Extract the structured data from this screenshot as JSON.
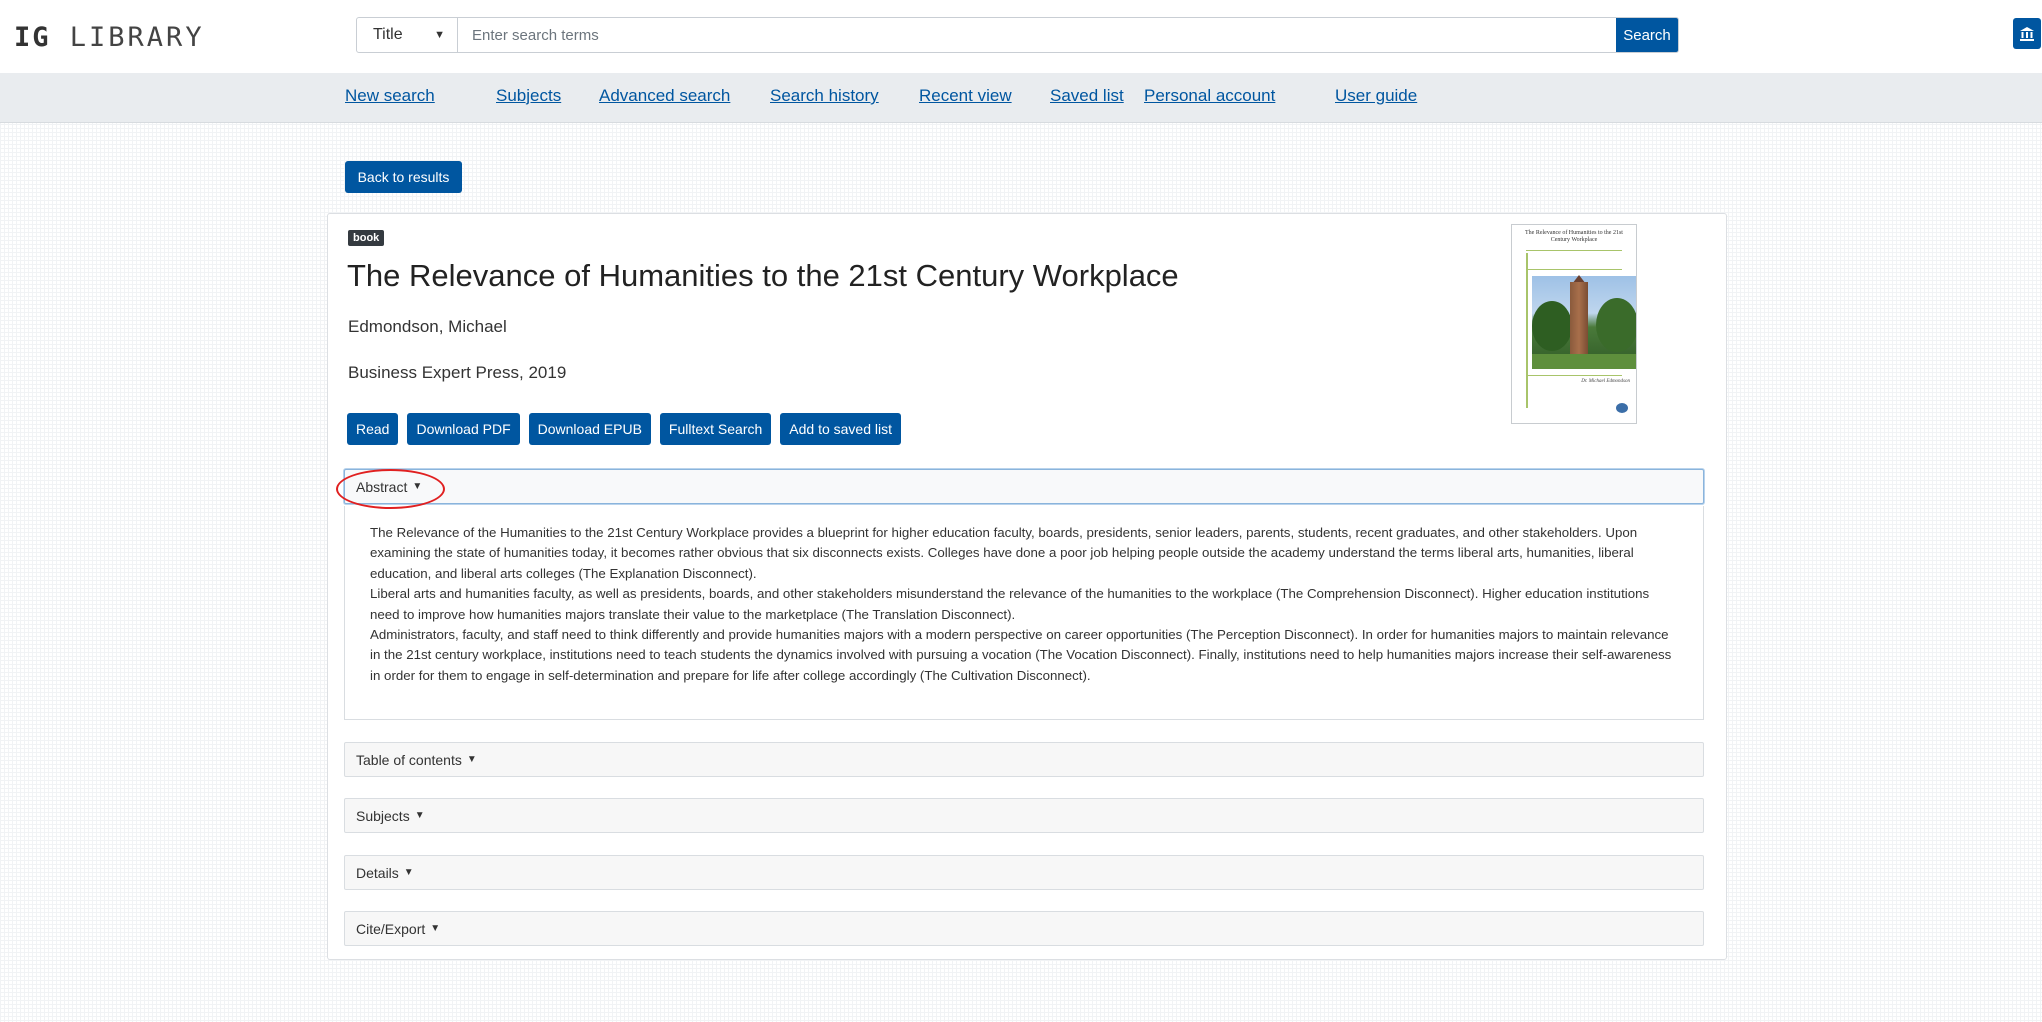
{
  "header": {
    "logo_bold": "IG",
    "logo_rest": "LIBRARY",
    "search_field": "Title",
    "search_placeholder": "Enter search terms",
    "search_button": "Search",
    "institution_icon": "bank-icon"
  },
  "nav": {
    "items": [
      "New search",
      "Subjects",
      "Advanced search",
      "Search history",
      "Recent view",
      "Saved list",
      "Personal account",
      "User guide"
    ]
  },
  "back_button": "Back to results",
  "record": {
    "type_badge": "book",
    "title": "The Relevance of Humanities to the 21st Century Workplace",
    "author": "Edmondson, Michael",
    "publisher": "Business Expert Press, 2019",
    "actions": [
      "Read",
      "Download PDF",
      "Download EPUB",
      "Fulltext Search",
      "Add to saved list"
    ],
    "cover": {
      "title": "The Relevance of Humanities to the 21st Century Workplace",
      "author": "Dr. Michael Edmondson"
    }
  },
  "sections": {
    "abstract": "Abstract",
    "toc": "Table of contents",
    "subjects": "Subjects",
    "details": "Details",
    "cite": "Cite/Export"
  },
  "abstract": {
    "paragraphs": [
      "The Relevance of the Humanities to the 21st Century Workplace provides a blueprint for higher education faculty, boards, presidents, senior leaders, parents, students, recent graduates, and other stakeholders. Upon examining the state of humanities today, it becomes rather obvious that six disconnects exists. Colleges have done a poor job helping people outside the academy understand the terms liberal arts, humanities, liberal education, and liberal arts colleges (The Explanation Disconnect).",
      "Liberal arts and humanities faculty, as well as presidents, boards, and other stakeholders misunderstand the relevance of the humanities to the workplace (The Comprehension Disconnect). Higher education institutions need to improve how humanities majors translate their value to the marketplace (The Translation Disconnect).",
      "Administrators, faculty, and staff need to think differently and provide humanities majors with a modern perspective on career opportunities (The Perception Disconnect). In order for humanities majors to maintain relevance in the 21st century workplace, institutions need to teach students the dynamics involved with pursuing a vocation (The Vocation Disconnect). Finally, institutions need to help humanities majors increase their self-awareness in order for them to engage in self-determination and prepare for life after college accordingly (The Cultivation Disconnect)."
    ]
  },
  "colors": {
    "primary": "#0056a0",
    "nav_background": "#e9ecef",
    "highlight_circle": "#e02020"
  }
}
